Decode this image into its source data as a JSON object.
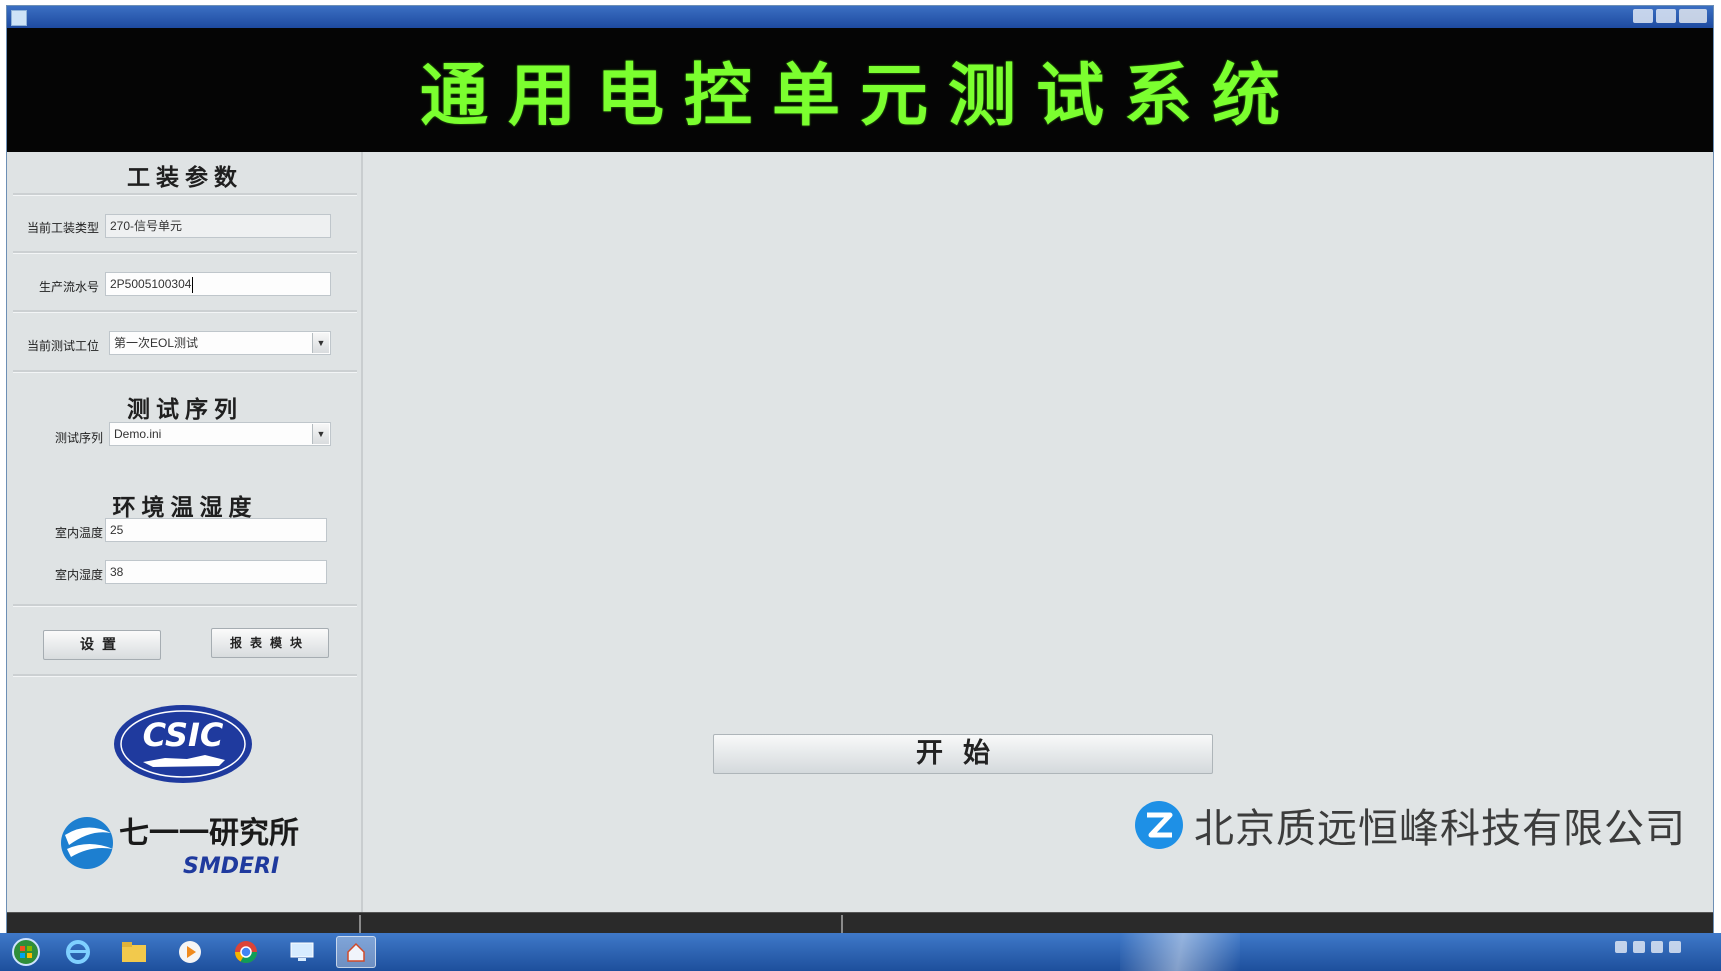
{
  "window": {
    "title": "",
    "banner_title": "通用电控单元测试系统"
  },
  "left_panel": {
    "tooling_section_title": "工装参数",
    "current_tooling_type": {
      "label": "当前工装类型",
      "value": "270-信号单元"
    },
    "production_serial": {
      "label": "生产流水号",
      "value": "2P5005100304"
    },
    "current_test_station": {
      "label": "当前测试工位",
      "value": "第一次EOL测试"
    },
    "sequence_section_title": "测试序列",
    "test_sequence": {
      "label": "测试序列",
      "value": "Demo.ini"
    },
    "env_section_title": "环境温湿度",
    "room_temperature": {
      "label": "室内温度",
      "value": "25"
    },
    "room_humidity": {
      "label": "室内湿度",
      "value": "38"
    },
    "settings_button": "设置",
    "report_button": "报表模块",
    "logos": {
      "csic": "CSIC",
      "institute_cn": "七一一研究所",
      "institute_en": "SMDERI"
    }
  },
  "main": {
    "start_button": "开始"
  },
  "watermark": {
    "company": "北京质远恒峰科技有限公司"
  },
  "taskbar": {
    "items": [
      "start-orb",
      "ie-icon",
      "explorer-icon",
      "media-player-icon",
      "chrome-icon",
      "remote-desktop-icon",
      "app-icon"
    ],
    "clock_time": "",
    "clock_date": ""
  },
  "colors": {
    "banner_bg": "#050505",
    "banner_text": "#7bff2f",
    "panel_bg": "#dfe3e4",
    "taskbar": "#2a5fb0",
    "csic_blue": "#1f3a9e"
  }
}
